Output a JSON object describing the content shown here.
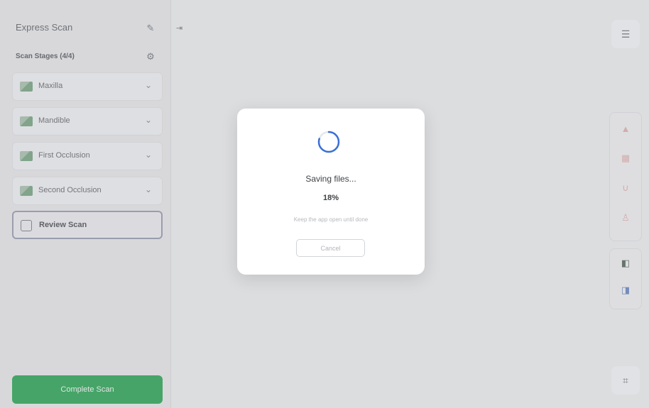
{
  "sidebar": {
    "title": "Express Scan",
    "stages_header": "Scan Stages (4/4)",
    "stages": [
      {
        "label": "Maxilla"
      },
      {
        "label": "Mandible"
      },
      {
        "label": "First Occlusion"
      },
      {
        "label": "Second Occlusion"
      }
    ],
    "review_label": "Review Scan",
    "complete_label": "Complete Scan"
  },
  "modal": {
    "title": "Saving files...",
    "progress_text": "18%",
    "progress": 0.18,
    "note": "Keep the app open until done",
    "cancel_label": "Cancel"
  },
  "icons": {
    "edit": "pencil-icon",
    "collapse": "collapse-panel-icon",
    "settings": "sliders-icon",
    "toolbar_top": "layers-add-icon",
    "toolbar_bottom": "scan-view-icon"
  },
  "colors": {
    "complete_button": "#1e9b4a",
    "review_border": "#8d92a8",
    "spinner": "#3b6fd8"
  }
}
